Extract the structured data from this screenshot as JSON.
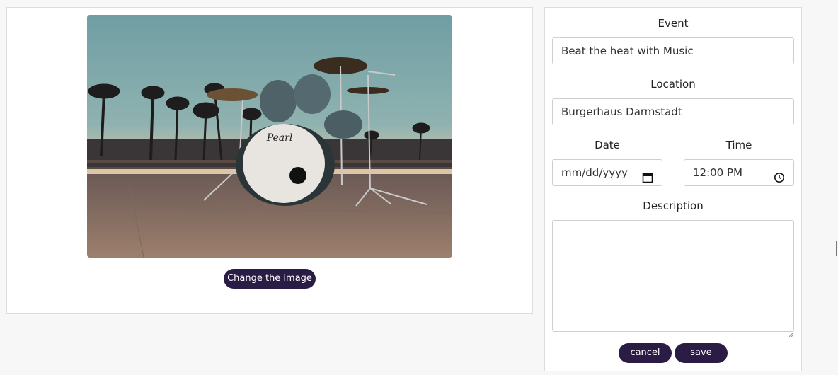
{
  "image_panel": {
    "image_alt": "Pearl drum kit on a waterfront promenade at sunset with palm trees",
    "drum_brand": "Pearl",
    "change_image_label": "Change the image"
  },
  "form": {
    "event_label": "Event",
    "event_value": "Beat the heat with Music",
    "location_label": "Location",
    "location_value": "Burgerhaus Darmstadt",
    "date_label": "Date",
    "date_value": "mm/dd/yyyy",
    "time_label": "Time",
    "time_value": "12:00 PM",
    "description_label": "Description",
    "description_value": "",
    "cancel_label": "cancel",
    "save_label": "save"
  },
  "colors": {
    "button_bg": "#2a1c45",
    "page_bg": "#f7f7f7"
  },
  "icons": {
    "date": "calendar-icon",
    "time": "clock-icon"
  }
}
